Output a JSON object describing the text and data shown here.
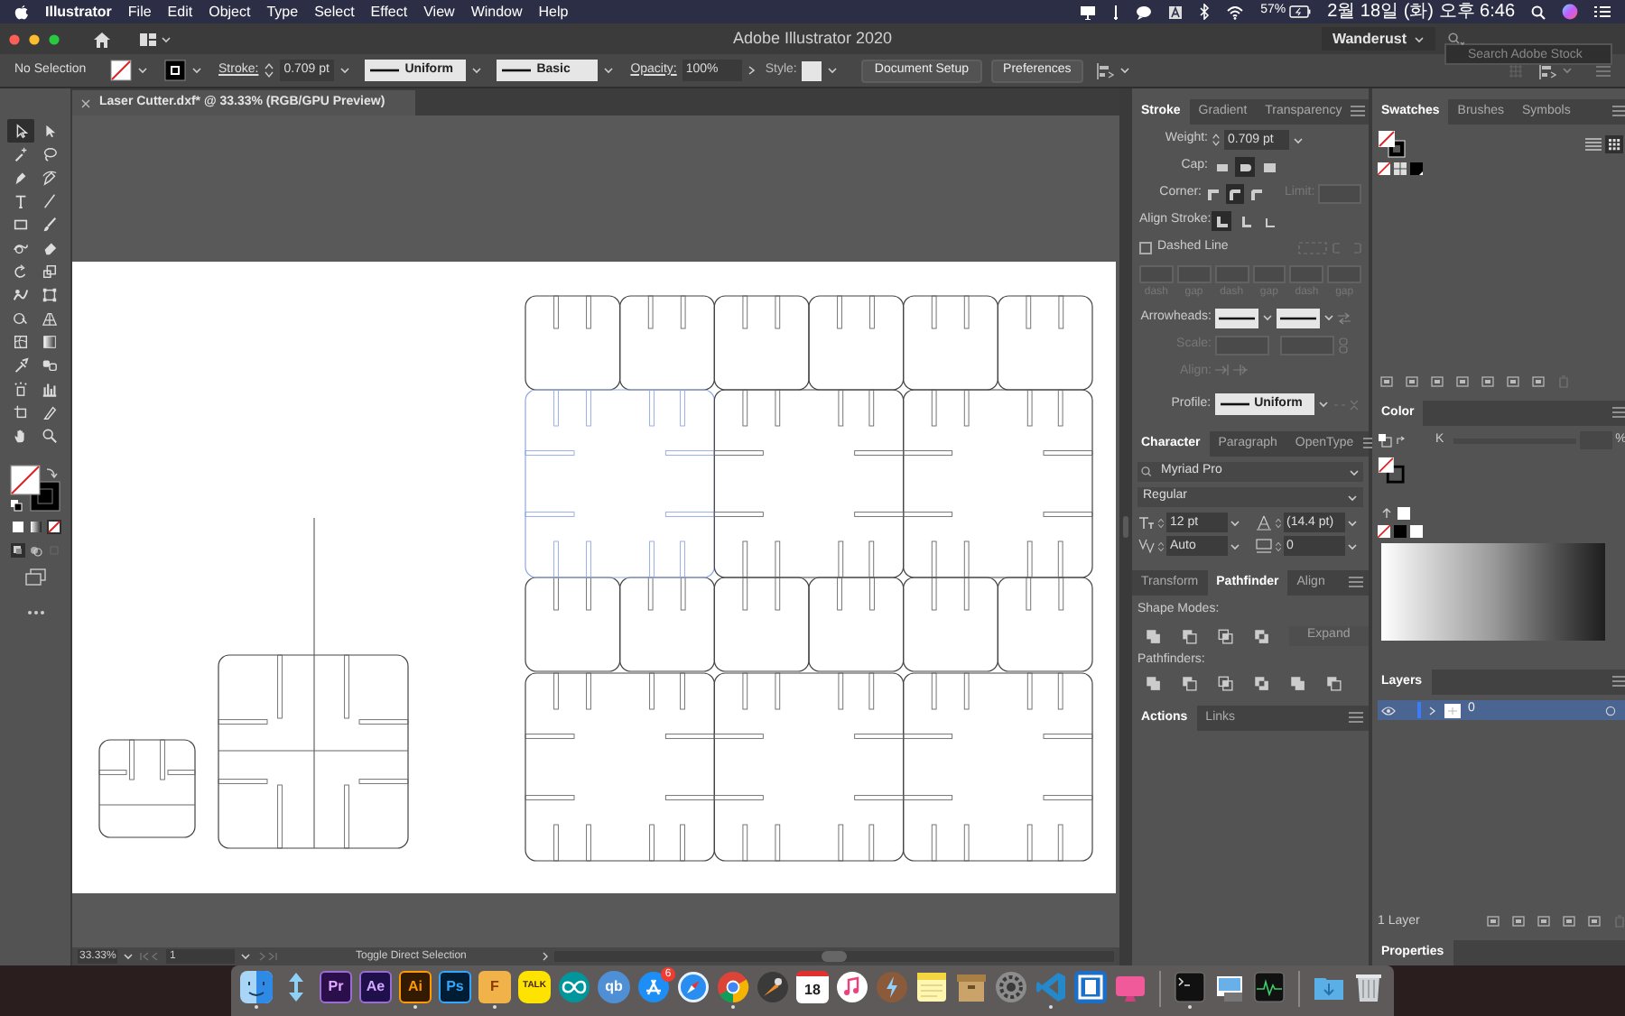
{
  "menubar": {
    "app": "Illustrator",
    "menus": [
      "File",
      "Edit",
      "Object",
      "Type",
      "Select",
      "Effect",
      "View",
      "Window",
      "Help"
    ],
    "battery": "57%",
    "clock": "2월 18일 (화) 오후 6:46"
  },
  "titlebar": {
    "title": "Adobe Illustrator 2020",
    "workspace": "Wanderust",
    "search": {
      "placeholder": "Search Adobe Stock"
    }
  },
  "control_bar": {
    "selection": "No Selection",
    "stroke_label": "Stroke:",
    "stroke_weight": "0.709 pt",
    "profile": "Uniform",
    "brush": "Basic",
    "opacity_label": "Opacity:",
    "opacity": "100%",
    "style_label": "Style:",
    "buttons": [
      "Document Setup",
      "Preferences"
    ]
  },
  "toolbar": {
    "tools": [
      {
        "kind": "selection",
        "selected": true
      },
      {
        "kind": "direct_selection",
        "selected": false
      },
      {
        "kind": "magic_wand",
        "selected": false
      },
      {
        "kind": "lasso",
        "selected": false
      },
      {
        "kind": "pen",
        "selected": false
      },
      {
        "kind": "curvature",
        "selected": false
      },
      {
        "kind": "type",
        "selected": false
      },
      {
        "kind": "line",
        "selected": false
      },
      {
        "kind": "rectangle",
        "selected": false
      },
      {
        "kind": "paintbrush",
        "selected": false
      },
      {
        "kind": "shaper",
        "selected": false
      },
      {
        "kind": "eraser",
        "selected": false
      },
      {
        "kind": "rotate",
        "selected": false
      },
      {
        "kind": "scale",
        "selected": false
      },
      {
        "kind": "warp",
        "selected": false
      },
      {
        "kind": "free_transform",
        "selected": false
      },
      {
        "kind": "shape_builder",
        "selected": false
      },
      {
        "kind": "perspective",
        "selected": false
      },
      {
        "kind": "mesh",
        "selected": false
      },
      {
        "kind": "gradient",
        "selected": false
      },
      {
        "kind": "eyedropper",
        "selected": false
      },
      {
        "kind": "blend",
        "selected": false
      },
      {
        "kind": "symbol_sprayer",
        "selected": false
      },
      {
        "kind": "graph",
        "selected": false
      },
      {
        "kind": "artboard",
        "selected": false
      },
      {
        "kind": "slice",
        "selected": false
      },
      {
        "kind": "hand",
        "selected": false
      },
      {
        "kind": "zoom",
        "selected": false
      }
    ]
  },
  "document": {
    "tab": "Laser Cutter.dxf* @ 33.33% (RGB/GPU Preview)",
    "zoom": "33.33%",
    "artboard": "1",
    "status": "Toggle Direct Selection"
  },
  "stroke_panel": {
    "tabs": [
      {
        "label": "Stroke",
        "selected": true
      },
      {
        "label": "Gradient",
        "selected": false
      },
      {
        "label": "Transparency",
        "selected": false
      }
    ],
    "weight_label": "Weight:",
    "weight": "0.709 pt",
    "cap_label": "Cap:",
    "caps": [
      {
        "selected": false
      },
      {
        "selected": true
      },
      {
        "selected": false
      }
    ],
    "corner_label": "Corner:",
    "corners": [
      {
        "selected": false
      },
      {
        "selected": true
      },
      {
        "selected": false
      }
    ],
    "limit": {
      "label": "Limit:",
      "disabled": true
    },
    "align_label": "Align Stroke:",
    "aligns": [
      {
        "selected": true
      },
      {
        "selected": false
      },
      {
        "selected": false
      }
    ],
    "dashed": {
      "label": "Dashed Line",
      "checked": false
    },
    "dash_fields": [
      {
        "label": "dash",
        "disabled": true
      },
      {
        "label": "gap",
        "disabled": true
      },
      {
        "label": "dash",
        "disabled": true
      },
      {
        "label": "gap",
        "disabled": true
      },
      {
        "label": "dash",
        "disabled": true
      },
      {
        "label": "gap",
        "disabled": true
      }
    ],
    "arrowheads_label": "Arrowheads:",
    "scale": {
      "label": "Scale:",
      "disabled": true
    },
    "arrow_align": {
      "label": "Align:",
      "disabled": true
    },
    "profile_label": "Profile:",
    "profile": "Uniform"
  },
  "swatches_panel": {
    "tabs": [
      {
        "label": "Swatches",
        "selected": true
      },
      {
        "label": "Brushes",
        "selected": false
      },
      {
        "label": "Symbols",
        "selected": false
      }
    ]
  },
  "color_panel": {
    "title": "Color",
    "channel": "K",
    "unit": "%"
  },
  "character_panel": {
    "tabs": [
      {
        "label": "Character",
        "selected": true
      },
      {
        "label": "Paragraph",
        "selected": false
      },
      {
        "label": "OpenType",
        "selected": false
      }
    ],
    "font": "Myriad Pro",
    "style": "Regular",
    "size": "12 pt",
    "leading": "(14.4 pt)",
    "kerning": "Auto",
    "tracking": "0"
  },
  "pathfinder_panel": {
    "tabs": [
      {
        "label": "Transform",
        "selected": false
      },
      {
        "label": "Pathfinder",
        "selected": true
      },
      {
        "label": "Align",
        "selected": false
      }
    ],
    "shape_modes_label": "Shape Modes:",
    "expand": {
      "label": "Expand",
      "disabled": true
    },
    "pathfinders_label": "Pathfinders:"
  },
  "actions_panel": {
    "tabs": [
      {
        "label": "Actions",
        "selected": true
      },
      {
        "label": "Links",
        "selected": false
      }
    ]
  },
  "layers_panel": {
    "title": "Layers",
    "layers": [
      {
        "name": "0",
        "selected": true,
        "visible": true
      }
    ],
    "count": "1 Layer"
  },
  "properties_tab": "Properties",
  "dock": [
    {
      "kind": "finder",
      "running": true
    },
    {
      "kind": "migration",
      "running": false
    },
    {
      "kind": "premiere",
      "label": "Pr",
      "running": false
    },
    {
      "kind": "after_effects",
      "label": "Ae",
      "running": false
    },
    {
      "kind": "illustrator",
      "label": "Ai",
      "running": true
    },
    {
      "kind": "photoshop",
      "label": "Ps",
      "running": false
    },
    {
      "kind": "fusion",
      "label": "F",
      "running": true
    },
    {
      "kind": "talk",
      "label": "TALK",
      "running": false
    },
    {
      "kind": "arduino",
      "running": false
    },
    {
      "kind": "qb",
      "label": "qb",
      "running": false
    },
    {
      "kind": "app_store",
      "badge": "6",
      "running": false
    },
    {
      "kind": "safari",
      "running": false
    },
    {
      "kind": "chrome",
      "running": true
    },
    {
      "kind": "rocket",
      "running": false
    },
    {
      "kind": "calendar",
      "label": "18",
      "running": false
    },
    {
      "kind": "music",
      "running": false
    },
    {
      "kind": "bolt",
      "running": false
    },
    {
      "kind": "notes",
      "running": false
    },
    {
      "kind": "archive",
      "running": false
    },
    {
      "kind": "gear",
      "running": false
    },
    {
      "kind": "vscode",
      "running": true
    },
    {
      "kind": "window",
      "running": false
    },
    {
      "kind": "pink",
      "running": false
    },
    {
      "kind": "separator"
    },
    {
      "kind": "terminal",
      "running": true
    },
    {
      "kind": "preview",
      "running": false
    },
    {
      "kind": "activity",
      "running": false
    },
    {
      "kind": "separator"
    },
    {
      "kind": "folder",
      "running": false
    },
    {
      "kind": "trash",
      "running": false
    }
  ]
}
